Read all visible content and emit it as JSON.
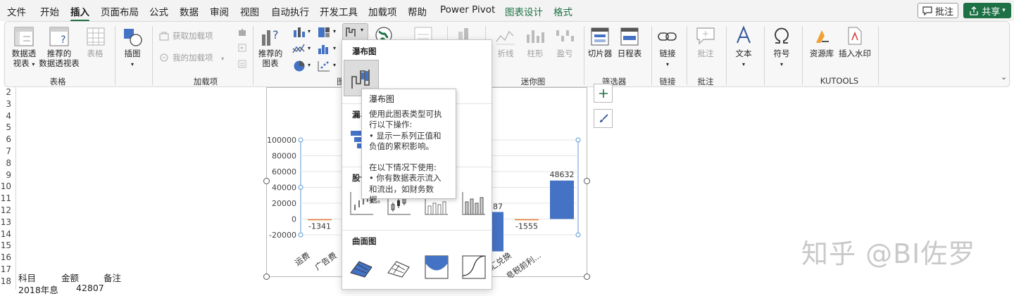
{
  "menubar": {
    "tabs": [
      {
        "label": "文件",
        "active": false
      },
      {
        "label": "开始",
        "active": false
      },
      {
        "label": "插入",
        "active": true
      },
      {
        "label": "页面布局",
        "active": false
      },
      {
        "label": "公式",
        "active": false
      },
      {
        "label": "数据",
        "active": false
      },
      {
        "label": "审阅",
        "active": false
      },
      {
        "label": "视图",
        "active": false
      },
      {
        "label": "自动执行",
        "active": false
      },
      {
        "label": "开发工具",
        "active": false
      },
      {
        "label": "加载项",
        "active": false
      },
      {
        "label": "帮助",
        "active": false
      },
      {
        "label": "Power Pivot",
        "active": false
      },
      {
        "label": "图表设计",
        "active": false,
        "contextual": true
      },
      {
        "label": "格式",
        "active": false,
        "contextual": true
      }
    ],
    "comment_button": "批注",
    "share_button": "共享",
    "accent_color": "#1e7145"
  },
  "ribbon": {
    "tables_group": {
      "pivot_table": "数据透\n视表",
      "recommended_pivot": "推荐的\n数据透视表",
      "table": "表格",
      "label": "表格"
    },
    "illustrations": {
      "label": "插图"
    },
    "addins_group": {
      "get_addins": "获取加载项",
      "my_addins": "我的加载项",
      "label": "加载项"
    },
    "charts_group": {
      "recommended_charts": "推荐的\n图表",
      "label": "图"
    },
    "sparklines_group": {
      "line": "折线",
      "column": "柱形",
      "winloss": "盈亏",
      "label": "迷你图"
    },
    "filters_group": {
      "slicer": "切片器",
      "timeline": "日程表",
      "label": "筛选器"
    },
    "links_group": {
      "link": "链接",
      "label": "链接"
    },
    "comments_group": {
      "comment": "批注",
      "label": "批注"
    },
    "text_group": {
      "text": "文本"
    },
    "symbols_group": {
      "symbol": "符号"
    },
    "kutools_group": {
      "resource_library": "资源库",
      "insert_watermark": "插入水印",
      "label": "KUTOOLS"
    }
  },
  "dropdown": {
    "waterfall_header": "瀑布图",
    "funnel_header": "漏斗",
    "stock_header": "股价",
    "surface_header": "曲面图"
  },
  "tooltip": {
    "title": "瀑布图",
    "line1": "使用此图表类型可执行以下操作:",
    "line2": "• 显示一系列正值和负值的累积影响。",
    "line3": "在以下情况下使用:",
    "line4": "• 你有数据表示流入和流出，如财务数据。"
  },
  "sheet": {
    "row_numbers": [
      "2",
      "3",
      "4",
      "5",
      "6",
      "7",
      "8",
      "9",
      "10",
      "11",
      "12",
      "13",
      "14",
      "15",
      "16",
      "17",
      "18"
    ],
    "header_row": {
      "col_a": "科目",
      "col_b": "金额",
      "col_c": "备注"
    },
    "row18": {
      "col_a": "2018年息",
      "col_b": "42807"
    }
  },
  "chart_data": {
    "type": "bar",
    "subtype": "waterfall",
    "yticks": [
      "100000",
      "80000",
      "60000",
      "40000",
      "20000",
      "0",
      "-20000"
    ],
    "ylim": [
      -20000,
      100000
    ],
    "categories": [
      "运费",
      "广告费",
      "外汇兑换",
      "息税前利..."
    ],
    "visible_data_labels": [
      {
        "category": "运费",
        "label": "-1341",
        "value": -1341
      },
      {
        "category": "外汇兑换",
        "label": "-1555",
        "value": -1555
      },
      {
        "category": "息税前利...",
        "label": "48632",
        "value": 48632
      }
    ],
    "partial_label": "87",
    "bar_color": "#4472c4",
    "negative_color": "#ed7d31"
  },
  "watermark": "知乎 @BI佐罗"
}
